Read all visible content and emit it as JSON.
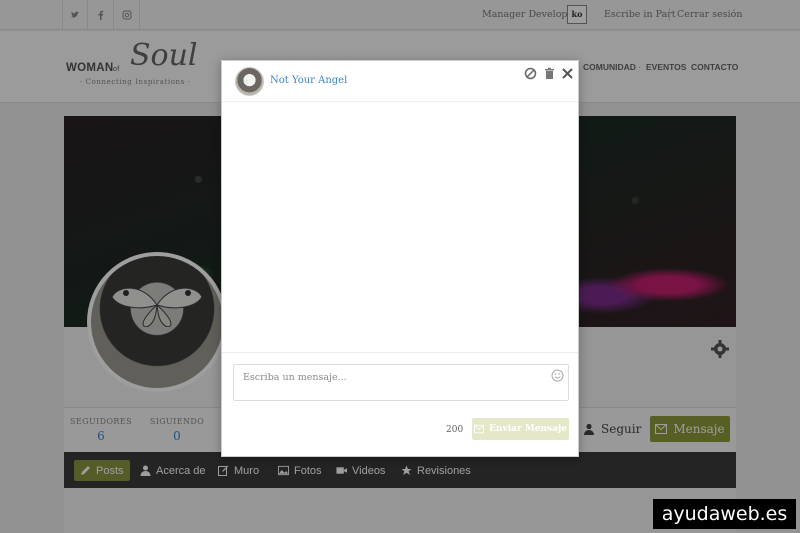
{
  "topbar": {
    "social": [
      "twitter-icon",
      "facebook-icon",
      "instagram-icon"
    ],
    "links": {
      "developer": "Manager Developer",
      "badge": "ko",
      "subscribe": "Escribe in Part",
      "logout": "Cerrar sesión"
    }
  },
  "header": {
    "logo": {
      "word": "WOMAN",
      "connector": "of",
      "script": "Soul",
      "tagline": "· Connecting Inspirations ·"
    },
    "nav": [
      "COMUNIDAD",
      "EVENTOS",
      "CONTACTO"
    ]
  },
  "profile": {
    "stats": [
      {
        "label": "SEGUIDORES",
        "value": "6"
      },
      {
        "label": "SIGUIENDO",
        "value": "0"
      }
    ],
    "follow_label": "Seguir",
    "message_label": "Mensaje",
    "tabs": [
      "Posts",
      "Acerca de",
      "Muro",
      "Fotos",
      "Videos",
      "Revisiones"
    ]
  },
  "chat": {
    "name": "Not Your Angel",
    "placeholder": "Escriba un mensaje...",
    "char_count": "200",
    "send_label": "Enviar Mensaje"
  },
  "watermark": "ayudaweb.es",
  "colors": {
    "accent": "#8a9540",
    "link": "#3a87c8",
    "send_disabled": "#e5e8c8"
  }
}
